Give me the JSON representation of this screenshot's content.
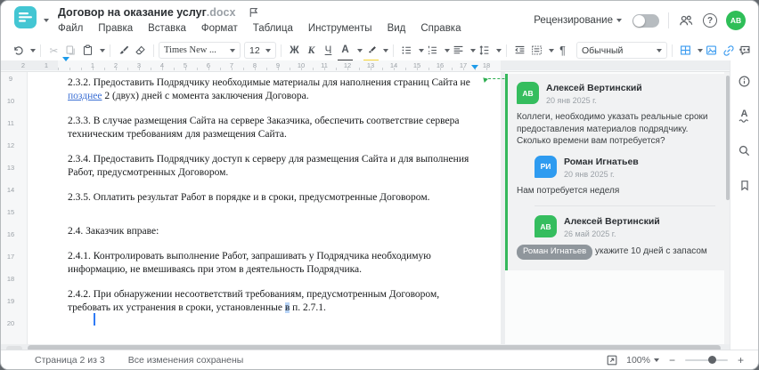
{
  "window": {
    "title": "Договор на оказание услуг",
    "title_ext": ".docx"
  },
  "header": {
    "review_label": "Рецензирование",
    "avatar_initials": "АВ",
    "help_glyph": "?"
  },
  "menu": {
    "items": [
      "Файл",
      "Правка",
      "Вставка",
      "Формат",
      "Таблица",
      "Инструменты",
      "Вид",
      "Справка"
    ]
  },
  "toolbar": {
    "cut_glyph": "✂",
    "font_name": "Times New ...",
    "font_size": "12",
    "bold_label": "Ж",
    "italic_label": "К",
    "underline_label": "Ч",
    "font_color_label": "А",
    "pilcrow": "¶",
    "style_name": "Обычный",
    "more_glyph": "⋯"
  },
  "ruler": {
    "h_numbers": [
      "2",
      "1",
      "",
      "1",
      "2",
      "3",
      "4",
      "5",
      "6",
      "7",
      "8",
      "9",
      "10",
      "11",
      "12",
      "13",
      "14",
      "15",
      "16",
      "17",
      "18"
    ],
    "v_numbers": [
      "9",
      "10",
      "11",
      "12",
      "13",
      "14",
      "15",
      "16",
      "17",
      "18",
      "19",
      "20"
    ]
  },
  "document": {
    "p232_pre": "2.3.2. Предоставить Подрядчику необходимые материалы для наполнения страниц Сайта не ",
    "p232_ins": "позднее",
    "p232_post": " 2 (двух) дней с момента заключения Договора.",
    "p233": "2.3.3. В случае размещения Сайта на сервере Заказчика, обеспечить соответствие сервера техническим требованиям для размещения Сайта.",
    "p234": "2.3.4. Предоставить Подрядчику доступ к серверу для размещения Сайта и для выполнения Работ, предусмотренных Договором.",
    "p235": "2.3.5. Оплатить результат Работ в порядке и в сроки, предусмотренные Договором.",
    "p24": "2.4. Заказчик вправе:",
    "p241": "2.4.1. Контролировать выполнение Работ, запрашивать у Подрядчика необходимую информацию, не вмешиваясь при этом в деятельность Подрядчика.",
    "p242_pre": "2.4.2. При обнаружении несоответствий требованиям, предусмотренным Договором, требовать их устранения в сроки, установленные ",
    "p242_sel": "в",
    "p242_post": " п. 2.7.1."
  },
  "comments": {
    "thread": [
      {
        "initials": "АВ",
        "name": "Алексей Вертинский",
        "date": "20 янв 2025 г.",
        "text": "Коллеги, необходимо указать реальные сроки предоставления материалов подрядчику. Сколько времени вам потребуется?"
      },
      {
        "initials": "РИ",
        "name": "Роман Игнатьев",
        "date": "20 янв 2025 г.",
        "text": "Нам потребуется неделя"
      },
      {
        "initials": "АВ",
        "name": "Алексей Вертинский",
        "date": "26 май 2025 г.",
        "mention": "Роман Игнатьев",
        "text": "укажите 10 дней с запасом"
      }
    ]
  },
  "sidebar": {
    "spell_letter": "А"
  },
  "statusbar": {
    "page_label": "Страница 2 из 3",
    "saved_label": "Все изменения сохранены",
    "zoom_value": "100%",
    "minus": "−",
    "plus": "+"
  },
  "colors": {
    "accent_teal": "#43c6d3",
    "comment_green": "#35b85c",
    "user_blue": "#2e9bf0",
    "toolbar_blue": "#3e9df0"
  }
}
